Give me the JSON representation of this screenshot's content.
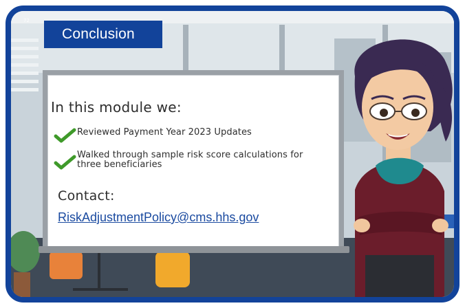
{
  "slide": {
    "badge": "72",
    "title": "Conclusion"
  },
  "board": {
    "heading": "In this module we:",
    "items": [
      "Reviewed Payment Year 2023 Updates",
      "Walked through sample risk score calculations for three beneficiaries"
    ],
    "contact_label": "Contact:",
    "email": "RiskAdjustmentPolicy@cms.hhs.gov"
  },
  "colors": {
    "frame": "#12439a",
    "title_bg": "#12439a",
    "check": "#3f9a2a",
    "link": "#1a4aa0"
  }
}
